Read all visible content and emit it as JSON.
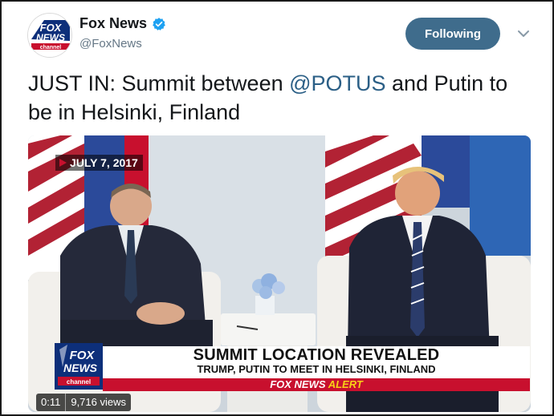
{
  "account": {
    "display_name": "Fox News",
    "handle": "@FoxNews",
    "avatar_text_top": "FOX",
    "avatar_text_bottom": "NEWS",
    "avatar_text_channel": "channel",
    "verified": true
  },
  "actions": {
    "follow_label": "Following",
    "menu_icon": "chevron-down-icon"
  },
  "tweet": {
    "text_prefix": "JUST IN: Summit between ",
    "mention": "@POTUS",
    "text_suffix": " and Putin to be in Helsinki, Finland"
  },
  "video": {
    "date_tag": "JULY 7, 2017",
    "logo_top": "FOX",
    "logo_bottom": "NEWS",
    "logo_channel": "channel",
    "headline": "SUMMIT LOCATION REVEALED",
    "subheadline": "TRUMP, PUTIN TO MEET IN HELSINKI, FINLAND",
    "alert_prefix": "FOX NEWS",
    "alert_word": "ALERT",
    "duration": "0:11",
    "views": "9,716 views"
  },
  "colors": {
    "follow_button": "#3f6c8c",
    "mention": "#2b5f86",
    "alert_red": "#c8102e",
    "fox_blue": "#0d2f7a"
  }
}
